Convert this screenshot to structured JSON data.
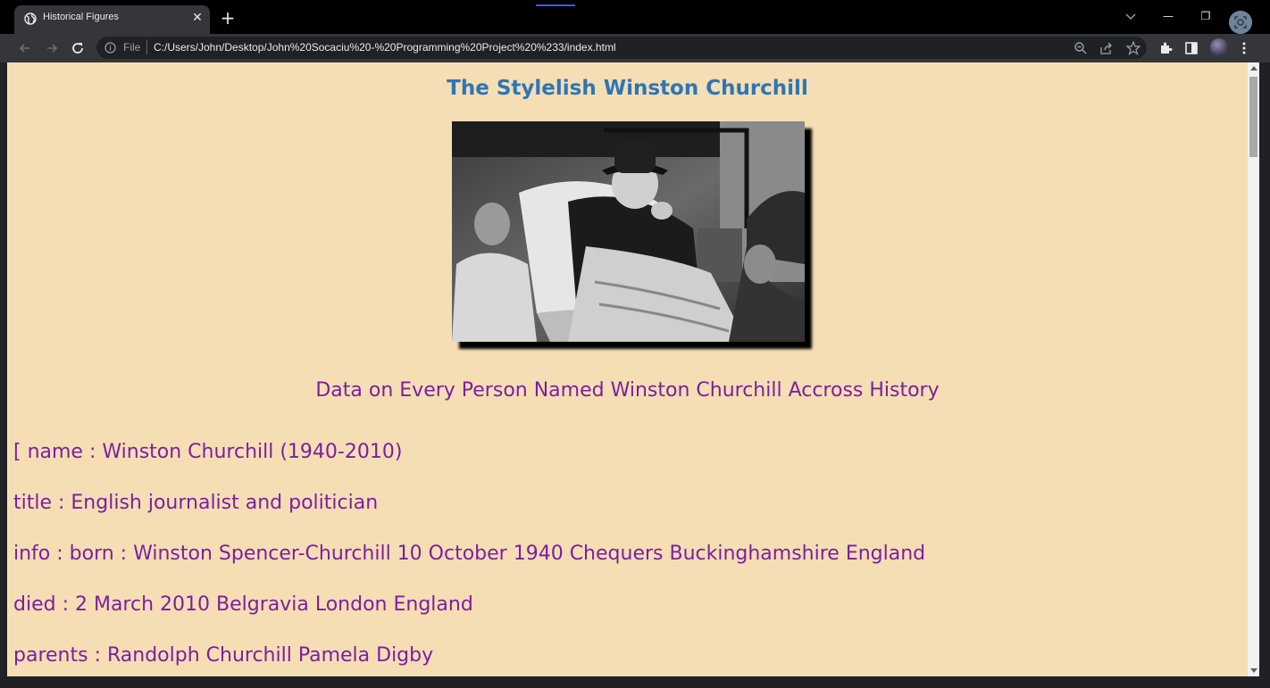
{
  "browser": {
    "tab_title": "Historical Figures",
    "new_tab_label": "+",
    "close_tab_label": "✕",
    "address_scheme_label": "File",
    "url": "C:/Users/John/Desktop/John%20Socaciu%20-%20Programming%20Project%20%233/index.html",
    "window_controls": {
      "minimize": "—",
      "restore": "❐",
      "close": "✕"
    },
    "accent_color": "#3d5afe"
  },
  "page": {
    "heading": "The Stylelish Winston Churchill",
    "subheading": "Data on Every Person Named Winston Churchill Accross History",
    "lines": [
      "[ name : Winston Churchill (1940-2010)",
      "title : English journalist and politician",
      "info : born : Winston Spencer-Churchill 10 October 1940 Chequers Buckinghamshire England",
      "died : 2 March 2010 Belgravia London England",
      "parents : Randolph Churchill Pamela Digby"
    ],
    "background_color": "#f5deb3",
    "heading_color": "#2e75b6",
    "text_color": "#7b1fa2"
  }
}
